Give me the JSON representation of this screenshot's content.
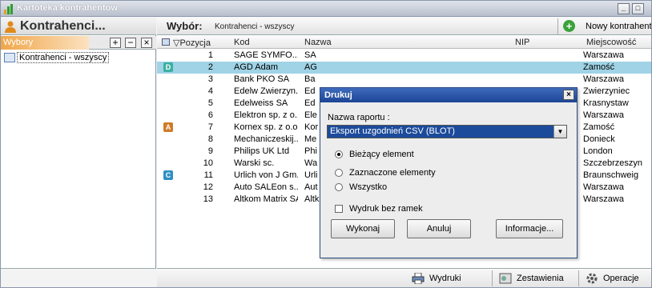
{
  "window": {
    "title": "Kartoteka kontrahentów",
    "min": "_",
    "max": "□"
  },
  "left": {
    "header": "Kontrahenci...",
    "tab": "Wybory",
    "plus": "+",
    "minus": "−",
    "close": "×",
    "tree": [
      "Kontrahenci - wszyscy"
    ]
  },
  "right": {
    "wybor_label": "Wybór:",
    "wybor_value": "Kontrahenci - wszyscy",
    "new_button": "Nowy kontrahent"
  },
  "columns": {
    "pos": "▽Pozycja",
    "kod": "Kod",
    "naz": "Nazwa",
    "nip": "NIP",
    "mie": "Miejscowość"
  },
  "rows": [
    {
      "pos": "1",
      "kod": "SAGE SYMFO...",
      "naz": "SA",
      "mie": "Warszawa",
      "badge": "",
      "sel": false
    },
    {
      "pos": "2",
      "kod": "AGD Adam",
      "naz": "AG",
      "mie": "Zamość",
      "badge": "D",
      "sel": true
    },
    {
      "pos": "3",
      "kod": "Bank PKO SA",
      "naz": "Ba",
      "mie": "Warszawa",
      "badge": "",
      "sel": false
    },
    {
      "pos": "4",
      "kod": "Edelw Zwierzyn...",
      "naz": "Ed",
      "mie": "Zwierzyniec",
      "badge": "",
      "sel": false
    },
    {
      "pos": "5",
      "kod": "Edelweiss SA",
      "naz": "Ed",
      "mie": "Krasnystaw",
      "badge": "",
      "sel": false
    },
    {
      "pos": "6",
      "kod": "Elektron sp. z o...",
      "naz": "Ele",
      "mie": "Warszawa",
      "badge": "",
      "sel": false
    },
    {
      "pos": "7",
      "kod": "Kornex sp. z o.o.",
      "naz": "Kor",
      "mie": "Zamość",
      "badge": "A",
      "sel": false
    },
    {
      "pos": "8",
      "kod": "Mechaniczeskij...",
      "naz": "Me",
      "mie": "Donieck",
      "badge": "",
      "sel": false
    },
    {
      "pos": "9",
      "kod": "Philips UK Ltd",
      "naz": "Phi",
      "mie": "London",
      "badge": "",
      "sel": false
    },
    {
      "pos": "10",
      "kod": "Warski sc.",
      "naz": "Wa",
      "mie": "Szczebrzeszyn",
      "badge": "",
      "sel": false
    },
    {
      "pos": "11",
      "kod": "Urlich von J Gm...",
      "naz": "Urli",
      "mie": "Braunschweig",
      "badge": "C",
      "sel": false
    },
    {
      "pos": "12",
      "kod": "Auto SALEon s...",
      "naz": "Aut",
      "mie": "Warszawa",
      "badge": "",
      "sel": false
    },
    {
      "pos": "13",
      "kod": "Altkom Matrix SA",
      "naz": "Altk",
      "mie": "Warszawa",
      "badge": "",
      "sel": false
    }
  ],
  "badge_colors": {
    "D": "#3ab0a2",
    "A": "#d07a28",
    "C": "#2f8fc4"
  },
  "bottom": {
    "wydruki": "Wydruki",
    "zestawienia": "Zestawienia",
    "operacje": "Operacje"
  },
  "dialog": {
    "title": "Drukuj",
    "close": "×",
    "label": "Nazwa raportu :",
    "report": "Eksport uzgodnień CSV (BLOT)",
    "combo_arrow": "▼",
    "opt_current": "Bieżący element",
    "opt_selected": "Zaznaczone elementy",
    "opt_all": "Wszystko",
    "chk_noframe": "Wydruk bez ramek",
    "btn_run": "Wykonaj",
    "btn_cancel": "Anuluj",
    "btn_info": "Informacje..."
  }
}
